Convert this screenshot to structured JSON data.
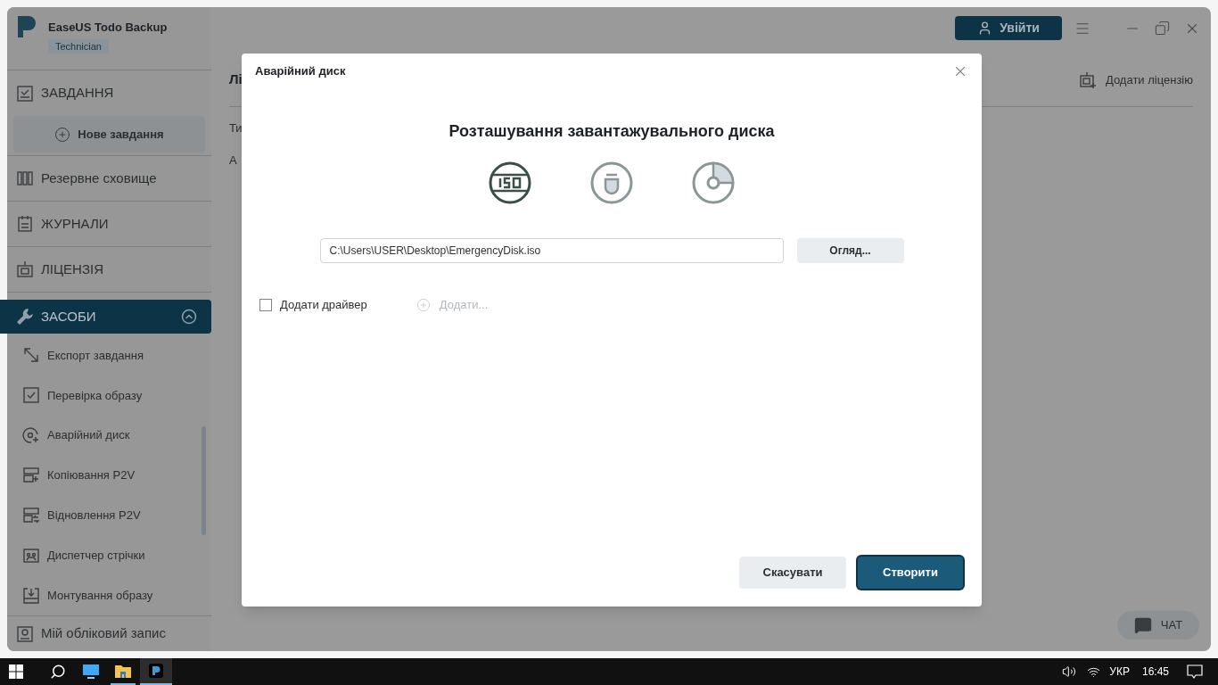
{
  "sidebar": {
    "app_name": "EaseUS Todo Backup",
    "edition": "Technician",
    "tasks": {
      "label": "ЗАВДАННЯ",
      "new_task": "Нове завдання"
    },
    "items": [
      {
        "label": "Резервне сховище",
        "kind": "storage",
        "selected": false
      },
      {
        "label": "ЖУРНАЛИ",
        "kind": "logs",
        "selected": false
      },
      {
        "label": "ЛІЦЕНЗІЯ",
        "kind": "license",
        "selected": false
      }
    ],
    "tools": {
      "label": "ЗАСОБИ",
      "selected": true,
      "expanded": true,
      "children": [
        {
          "label": "Експорт завдання",
          "kind": "export"
        },
        {
          "label": "Перевірка образу",
          "kind": "check"
        },
        {
          "label": "Аварійний диск",
          "kind": "disk"
        },
        {
          "label": "Копіювання P2V",
          "kind": "p2v-copy"
        },
        {
          "label": "Відновлення P2V",
          "kind": "p2v-restore"
        },
        {
          "label": "Диспетчер стрічки",
          "kind": "tape"
        },
        {
          "label": "Монтування образу",
          "kind": "mount"
        }
      ]
    },
    "account": "Мій обліковий запис"
  },
  "header": {
    "login_button": "Увійти"
  },
  "main": {
    "title": "Лі",
    "add_license": "Додати ліцензію",
    "rows": [
      "Ти",
      "А"
    ]
  },
  "dialog": {
    "title": "Аварійний диск",
    "heading": "Розташування завантажувального диска",
    "targets": [
      {
        "kind": "iso",
        "selected": true
      },
      {
        "kind": "usb",
        "selected": false
      },
      {
        "kind": "cd",
        "selected": false
      }
    ],
    "path": "C:\\Users\\USER\\Desktop\\EmergencyDisk.iso",
    "browse": "Огляд...",
    "add_driver": {
      "label": "Додати драйвер",
      "checked": false
    },
    "add": {
      "label": "Додати...",
      "disabled": true
    },
    "cancel": "Скасувати",
    "create": "Створити"
  },
  "chat": "ЧАТ",
  "taskbar": {
    "language": "УКР",
    "time": "16:45"
  }
}
